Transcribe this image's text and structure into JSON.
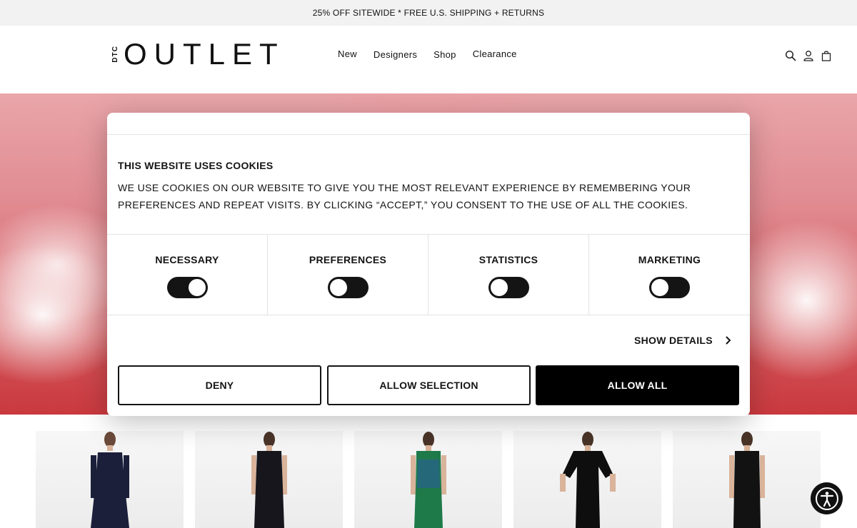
{
  "promo": {
    "text": "25% OFF SITEWIDE * FREE U.S. SHIPPING + RETURNS"
  },
  "header": {
    "logo_prefix": "DTC",
    "logo_main": "OUTLET",
    "nav": [
      {
        "label": "New"
      },
      {
        "label": "Designers"
      },
      {
        "label": "Shop"
      },
      {
        "label": "Clearance"
      }
    ],
    "icons": [
      "search-icon",
      "account-icon",
      "bag-icon"
    ]
  },
  "cookie_modal": {
    "title": "THIS WEBSITE USES COOKIES",
    "body": "WE USE COOKIES ON OUR WEBSITE TO GIVE YOU THE MOST RELEVANT EXPERIENCE BY REMEMBERING YOUR PREFERENCES AND REPEAT VISITS. BY CLICKING “ACCEPT,” YOU CONSENT TO THE USE OF ALL THE COOKIES.",
    "toggles": [
      {
        "label": "NECESSARY",
        "on": true
      },
      {
        "label": "PREFERENCES",
        "on": false
      },
      {
        "label": "STATISTICS",
        "on": false
      },
      {
        "label": "MARKETING",
        "on": false
      }
    ],
    "show_details": "SHOW DETAILS",
    "buttons": {
      "deny": "DENY",
      "allow_selection": "ALLOW SELECTION",
      "allow_all": "ALLOW ALL"
    }
  },
  "products": [
    {
      "dress_color": "#1c1f3a"
    },
    {
      "dress_color": "#16161c"
    },
    {
      "dress_color": "#1f7a4a"
    },
    {
      "dress_color": "#0e0e0e"
    },
    {
      "dress_color": "#121212"
    }
  ],
  "colors": {
    "promo_bg": "#f2f2f2",
    "primary": "#141414",
    "hero_red": "#d55b60"
  },
  "accessibility": {
    "icon": "accessibility-icon"
  }
}
